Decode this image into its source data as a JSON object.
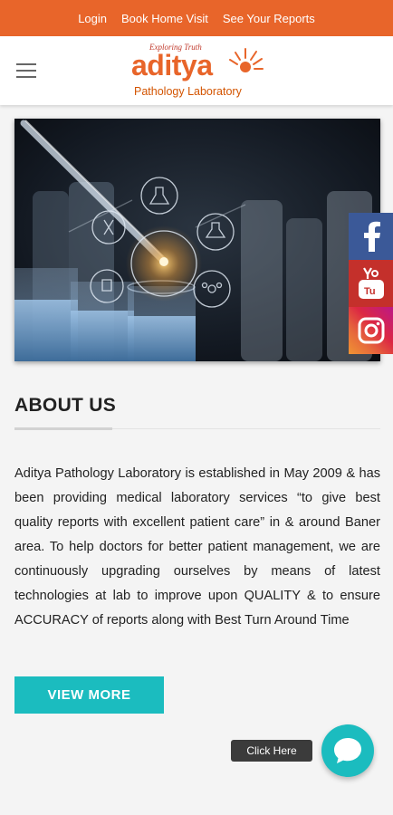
{
  "topbar": {
    "links": [
      "Login",
      "Book Home Visit",
      "See Your Reports"
    ],
    "bg": "#e8652a"
  },
  "header": {
    "logo": {
      "tagline": "Exploring Truth",
      "name": "aditya",
      "subtitle": "Pathology Laboratory"
    }
  },
  "social": {
    "facebook": "facebook-icon",
    "youtube": "youtube-icon",
    "instagram": "instagram-icon"
  },
  "about": {
    "title": "ABOUT US",
    "body": "Aditya Pathology Laboratory is established in May 2009 & has been providing medical laboratory services “to give best quality reports with excellent patient care” in & around Baner area. To help doctors for better patient management, we are continuously upgrading ourselves by means of latest technologies at lab to improve upon QUALITY & to ensure ACCURACY of reports along with Best Turn Around Time",
    "button_label": "VIEW MORE"
  },
  "chat": {
    "tooltip": "Click Here",
    "accent": "#1bbcbf"
  }
}
